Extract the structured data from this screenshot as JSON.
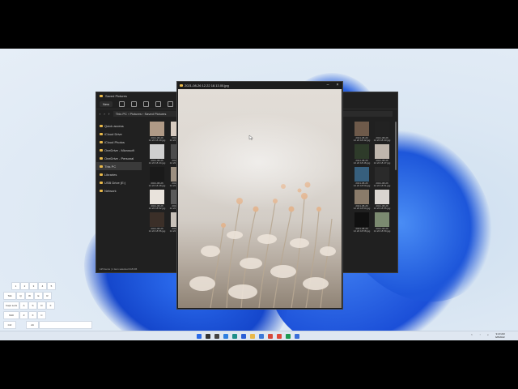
{
  "explorer": {
    "title": "Saved Pictures",
    "new_label": "New",
    "address": [
      "This PC",
      "Pictures",
      "Saved Pictures"
    ],
    "sidebar": [
      {
        "label": "Quick access",
        "selected": false
      },
      {
        "label": "iCloud Drive",
        "selected": false
      },
      {
        "label": "iCloud Photos",
        "selected": false
      },
      {
        "label": "OneDrive - Microsoft",
        "selected": false
      },
      {
        "label": "OneDrive - Personal",
        "selected": false
      },
      {
        "label": "This PC",
        "selected": true
      },
      {
        "label": "Libraries",
        "selected": false
      },
      {
        "label": "USB Drive (E:)",
        "selected": false
      },
      {
        "label": "Network",
        "selected": false
      }
    ],
    "thumbnails": [
      {
        "label": "2021-08-26 12.22 18.40.jpg",
        "color": "#b09a86"
      },
      {
        "label": "2021-08-26 12.22 18.41.jpg",
        "color": "#d7cbc0"
      },
      {
        "label": "2021-08-26 12.22 18.42.jpg",
        "color": "#6e5a4a"
      },
      {
        "label": "2021-08-26 12.22 18.43.jpg",
        "color": "#222222"
      },
      {
        "label": "2021-08-26 12.22 18.44.jpg",
        "color": "#cfcfcf"
      },
      {
        "label": "2021-08-26 12.22 18.45.jpg",
        "color": "#4c4c4c"
      },
      {
        "label": "2021-08-26 12.22 18.46.jpg",
        "color": "#2e3b2a"
      },
      {
        "label": "2021-08-26 12.22 18.47.jpg",
        "color": "#bfb6ad"
      },
      {
        "label": "2021-08-26 12.22 18.48.jpg",
        "color": "#1a1a1a"
      },
      {
        "label": "2021-08-26 12.22 18.49.jpg",
        "color": "#9c8f80"
      },
      {
        "label": "2021-08-26 12.22 18.50.jpg",
        "color": "#375f7d"
      },
      {
        "label": "2021-08-26 12.22 18.51.jpg",
        "color": "#2a2a2a"
      },
      {
        "label": "2021-08-26 12.22 18.52.jpg",
        "color": "#e9e3dc"
      },
      {
        "label": "2021-08-26 12.22 18.53.jpg",
        "color": "#5a5a5a"
      },
      {
        "label": "2021-08-26 12.22 18.54.jpg",
        "color": "#8a7b6a"
      },
      {
        "label": "2021-08-26 12.22 18.55.jpg",
        "color": "#d9d5d0"
      },
      {
        "label": "2021-08-26 12.22 18.56.jpg",
        "color": "#3b2f28"
      },
      {
        "label": "2021-08-26 12.22 18.57.jpg",
        "color": "#c8c1b9"
      },
      {
        "label": "2021-08-26 12.22 18.58.jpg",
        "color": "#101010"
      },
      {
        "label": "2021-08-26 12.22 18.59.jpg",
        "color": "#7b8a70"
      }
    ],
    "status": "125 items | 1 item selected 318 KB"
  },
  "viewer": {
    "title": "2021-08-26 12.22 18.13.00.jpg",
    "minimize": "–",
    "close": "×"
  },
  "keyboard": {
    "keys": [
      "1",
      "2",
      "3",
      "4",
      "5",
      "Tab",
      "Q",
      "W",
      "E",
      "R",
      "Caps Lock",
      "A",
      "S",
      "D",
      "F",
      "Shift",
      "Z",
      "X",
      "C",
      "Ctrl",
      "Alt"
    ]
  },
  "taskbar": {
    "icons": [
      {
        "name": "start-icon",
        "color": "#2b6be8"
      },
      {
        "name": "search-icon",
        "color": "#333333"
      },
      {
        "name": "task-view-icon",
        "color": "#444444"
      },
      {
        "name": "widgets-icon",
        "color": "#2f7fe0"
      },
      {
        "name": "edge-icon",
        "color": "#1e8f8a"
      },
      {
        "name": "store-icon",
        "color": "#2a5fd6"
      },
      {
        "name": "explorer-icon",
        "color": "#e8b84a"
      },
      {
        "name": "mail-icon",
        "color": "#3c78d8"
      },
      {
        "name": "photos-icon",
        "color": "#d6483a"
      },
      {
        "name": "chrome-icon",
        "color": "#e04a3a"
      },
      {
        "name": "spotify-icon",
        "color": "#1e9a52"
      },
      {
        "name": "app-icon",
        "color": "#3a6fd8"
      }
    ],
    "time": "9:23 AM",
    "date": "6/8/2022"
  }
}
